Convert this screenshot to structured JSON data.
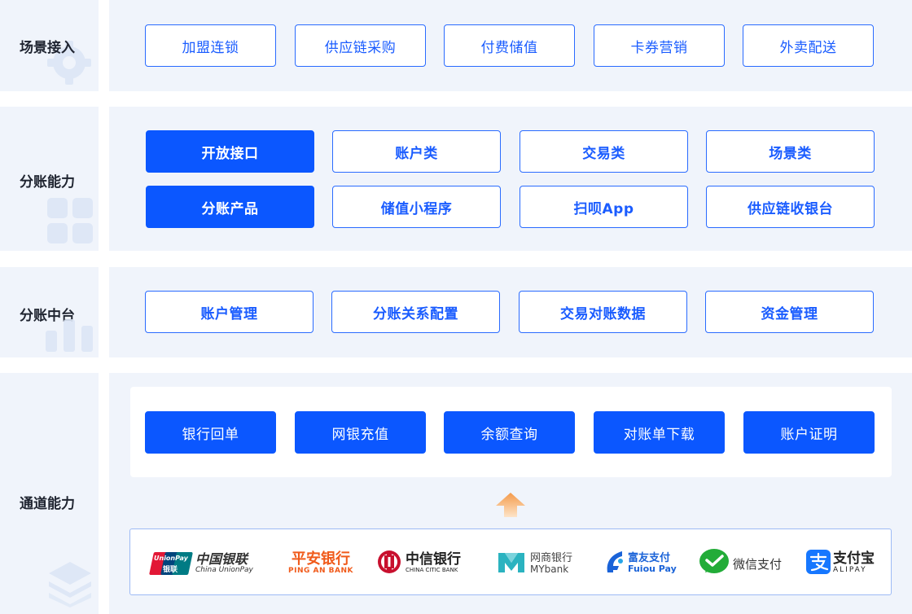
{
  "sections": {
    "scene": {
      "title": "场景接入",
      "items": [
        "加盟连锁",
        "供应链采购",
        "付费储值",
        "卡券营销",
        "外卖配送"
      ]
    },
    "capability": {
      "title": "分账能力",
      "row1": [
        "开放接口",
        "账户类",
        "交易类",
        "场景类"
      ],
      "row2": [
        "分账产品",
        "储值小程序",
        "扫呗App",
        "供应链收银台"
      ]
    },
    "middle": {
      "title": "分账中台",
      "items": [
        "账户管理",
        "分账关系配置",
        "交易对账数据",
        "资金管理"
      ]
    },
    "channel": {
      "title": "通道能力",
      "items": [
        "银行回单",
        "网银充值",
        "余额查询",
        "对账单下载",
        "账户证明"
      ]
    }
  },
  "logos": {
    "unionpay": {
      "badge_top": "UnionPay",
      "badge_bottom": "银联",
      "cn": "中国银联",
      "en": "China UnionPay"
    },
    "pingan": {
      "cn": "平安银行",
      "en": "PING AN BANK"
    },
    "citic": {
      "cn": "中信银行",
      "en": "CHINA CITIC BANK"
    },
    "mybank": {
      "cn": "网商银行",
      "en": "MYbank"
    },
    "fuiou": {
      "cn": "富友支付",
      "en": "Fuiou Pay"
    },
    "wechat": {
      "cn": "微信支付"
    },
    "alipay": {
      "cn": "支付宝",
      "en": "ALIPAY"
    }
  },
  "colors": {
    "primary": "#0b57ff",
    "panel_bg": "#f0f4fb",
    "arrow": "#f5a55a"
  }
}
